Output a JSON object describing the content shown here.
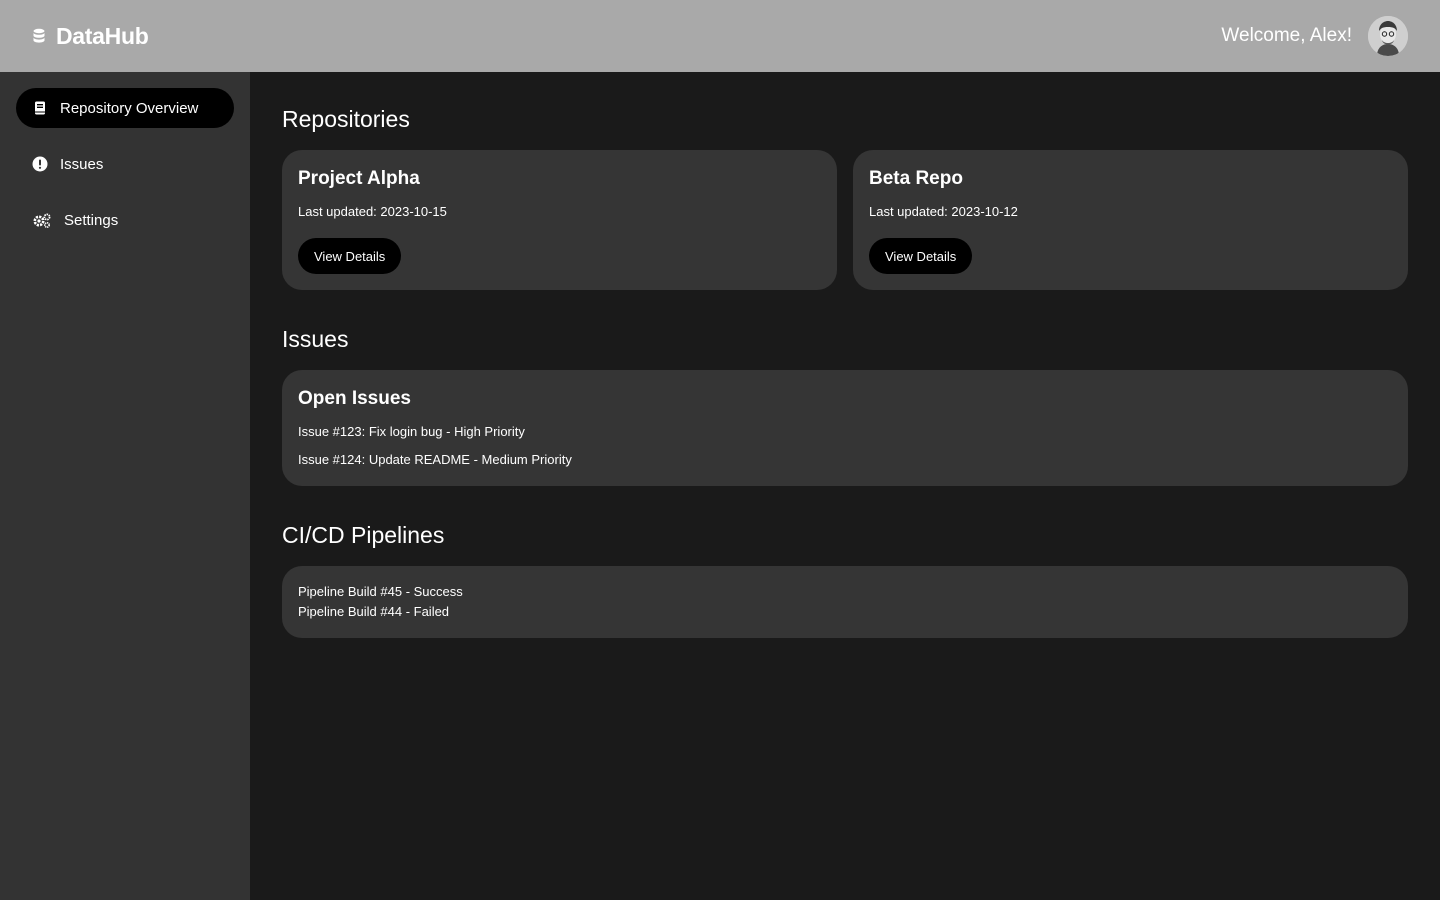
{
  "header": {
    "brand": "DataHub",
    "brand_icon": "database-icon",
    "welcome": "Welcome, Alex!",
    "avatar_icon": "user-avatar"
  },
  "sidebar": {
    "items": [
      {
        "label": "Repository Overview",
        "icon": "book-icon",
        "active": true
      },
      {
        "label": "Issues",
        "icon": "exclamation-circle-icon",
        "active": false
      },
      {
        "label": "Settings",
        "icon": "cogs-icon",
        "active": false
      }
    ]
  },
  "sections": {
    "repositories": {
      "title": "Repositories",
      "cards": [
        {
          "name": "Project Alpha",
          "updated": "Last updated: 2023-10-15",
          "button": "View Details"
        },
        {
          "name": "Beta Repo",
          "updated": "Last updated: 2023-10-12",
          "button": "View Details"
        }
      ]
    },
    "issues": {
      "title": "Issues",
      "card_title": "Open Issues",
      "items": [
        "Issue #123: Fix login bug - High Priority",
        "Issue #124: Update README - Medium Priority"
      ]
    },
    "pipelines": {
      "title": "CI/CD Pipelines",
      "items": [
        "Pipeline Build #45 - Success",
        "Pipeline Build #44 - Failed"
      ]
    }
  },
  "colors": {
    "header_bg": "#a9a9a9",
    "sidebar_bg": "#333333",
    "main_bg": "#1a1a1a",
    "card_bg": "#353535",
    "button_bg": "#000000",
    "active_nav_bg": "#000000"
  }
}
